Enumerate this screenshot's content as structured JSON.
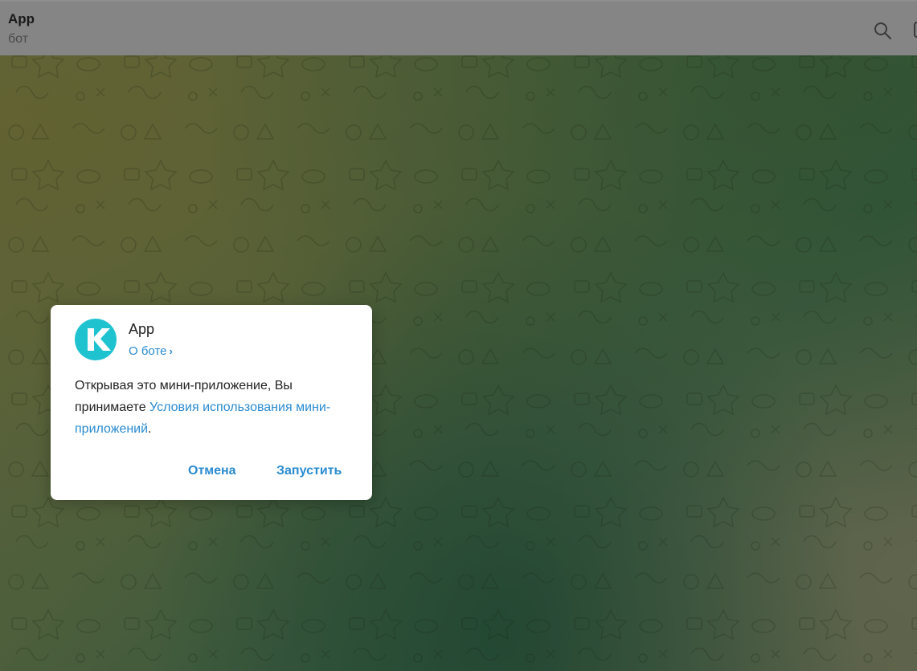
{
  "header": {
    "title": "App",
    "subtitle": "бот"
  },
  "icons": {
    "search": "search-icon",
    "more": "panel-icon",
    "avatar": "bot-avatar-k-logo"
  },
  "colors": {
    "link": "#2a8bd0",
    "avatar_bg": "#1fc3d0"
  },
  "dialog": {
    "bot_name": "App",
    "about_label": "О боте",
    "about_chevron": "›",
    "text_before": "Открывая это мини-приложение, Вы принимаете ",
    "terms_link": "Условия использования мини-приложений",
    "text_after": ".",
    "cancel_label": "Отмена",
    "launch_label": "Запустить"
  }
}
